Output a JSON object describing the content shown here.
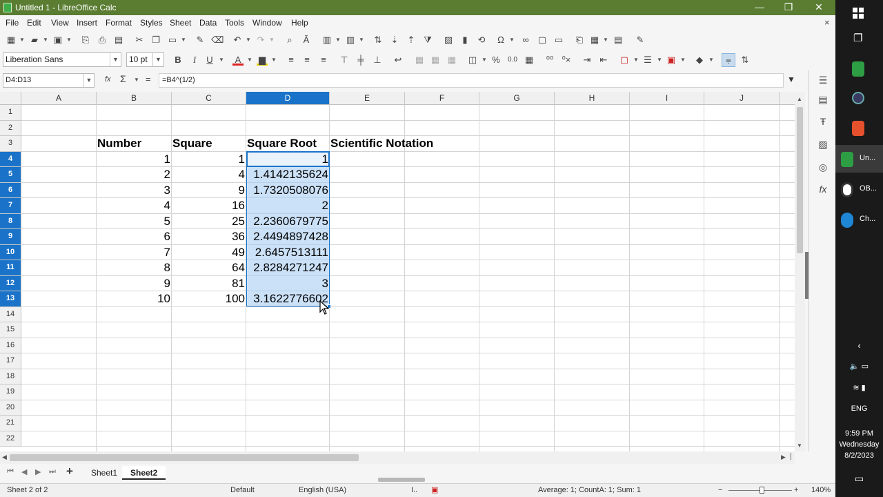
{
  "window": {
    "title": "Untitled 1 - LibreOffice Calc",
    "minimize": "—",
    "maximize": "❐",
    "close": "✕"
  },
  "menu": [
    "File",
    "Edit",
    "View",
    "Insert",
    "Format",
    "Styles",
    "Sheet",
    "Data",
    "Tools",
    "Window",
    "Help"
  ],
  "font": {
    "name": "Liberation Sans",
    "size": "10 pt"
  },
  "formula": {
    "cell_range": "D4:D13",
    "fx": "fx",
    "sigma": "Σ",
    "equals": "=",
    "content": "=B4^(1/2)"
  },
  "columns": [
    "A",
    "B",
    "C",
    "D",
    "E",
    "F",
    "G",
    "H",
    "I",
    "J"
  ],
  "selected_column": "D",
  "rows": [
    "1",
    "2",
    "3",
    "4",
    "5",
    "6",
    "7",
    "8",
    "9",
    "10",
    "11",
    "12",
    "13",
    "14",
    "15",
    "16",
    "17",
    "18",
    "19",
    "20",
    "21",
    "22"
  ],
  "selected_rows": [
    "4",
    "5",
    "6",
    "7",
    "8",
    "9",
    "10",
    "11",
    "12",
    "13"
  ],
  "headers": {
    "number": "Number",
    "square": "Square",
    "square_root": "Square Root",
    "scientific": "Scientific Notation"
  },
  "table": [
    {
      "number": "1",
      "square": "1",
      "root": "1"
    },
    {
      "number": "2",
      "square": "4",
      "root": "1.4142135624"
    },
    {
      "number": "3",
      "square": "9",
      "root": "1.7320508076"
    },
    {
      "number": "4",
      "square": "16",
      "root": "2"
    },
    {
      "number": "5",
      "square": "25",
      "root": "2.2360679775"
    },
    {
      "number": "6",
      "square": "36",
      "root": "2.4494897428"
    },
    {
      "number": "7",
      "square": "49",
      "root": "2.6457513111"
    },
    {
      "number": "8",
      "square": "64",
      "root": "2.8284271247"
    },
    {
      "number": "9",
      "square": "81",
      "root": "3"
    },
    {
      "number": "10",
      "square": "100",
      "root": "3.1622776602"
    }
  ],
  "sheets": [
    "Sheet1",
    "Sheet2"
  ],
  "active_sheet": "Sheet2",
  "status": {
    "sheet": "Sheet 2 of 2",
    "page_style": "Default",
    "language": "English (USA)",
    "summary": "Average: 1; CountA: 1; Sum: 1",
    "zoom": "140%"
  },
  "taskbar": {
    "apps": [
      {
        "label": "Un...",
        "color": "#2e9e44"
      },
      {
        "label": "OB...",
        "color": "#333333"
      },
      {
        "label": "Ch...",
        "color": "#1f86d6"
      }
    ],
    "language": "ENG",
    "time": "9:59 PM",
    "day": "Wednesday",
    "date": "8/2/2023"
  },
  "colors": {
    "titlebar": "#5a7d32",
    "selection": "#1a73c8",
    "taskbar": "#1a1a1a"
  }
}
